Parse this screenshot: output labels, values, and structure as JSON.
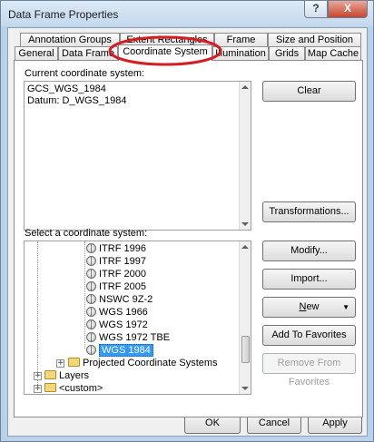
{
  "window": {
    "title": "Data Frame Properties",
    "help_glyph": "?",
    "close_glyph": "X"
  },
  "tabs_back": [
    "Annotation Groups",
    "Extent Rectangles",
    "Frame",
    "Size and Position"
  ],
  "tabs_front": [
    "General",
    "Data Frame",
    "Coordinate System",
    "Illumination",
    "Grids",
    "Map Cache"
  ],
  "current_cs": {
    "label": "Current coordinate system:",
    "lines": [
      "GCS_WGS_1984",
      "Datum: D_WGS_1984"
    ]
  },
  "select_cs": {
    "label": "Select a coordinate system:",
    "items": [
      "ITRF 1996",
      "ITRF 1997",
      "ITRF 2000",
      "ITRF 2005",
      "NSWC 9Z-2",
      "WGS 1966",
      "WGS 1972",
      "WGS 1972 TBE",
      "WGS 1984"
    ],
    "selected": "WGS 1984",
    "folders": [
      "Projected Coordinate Systems",
      "Layers",
      "<custom>"
    ]
  },
  "buttons": {
    "clear": "Clear",
    "transformations": "Transformations...",
    "modify": "Modify...",
    "import": "Import...",
    "new_prefix": "N",
    "new_rest": "ew",
    "add_favorites": "Add To Favorites",
    "remove_favorites": "Remove From Favorites",
    "ok": "OK",
    "cancel": "Cancel",
    "apply": "Apply"
  },
  "colors": {
    "annotation_circle": "#d21f26",
    "selection": "#3399ff"
  }
}
